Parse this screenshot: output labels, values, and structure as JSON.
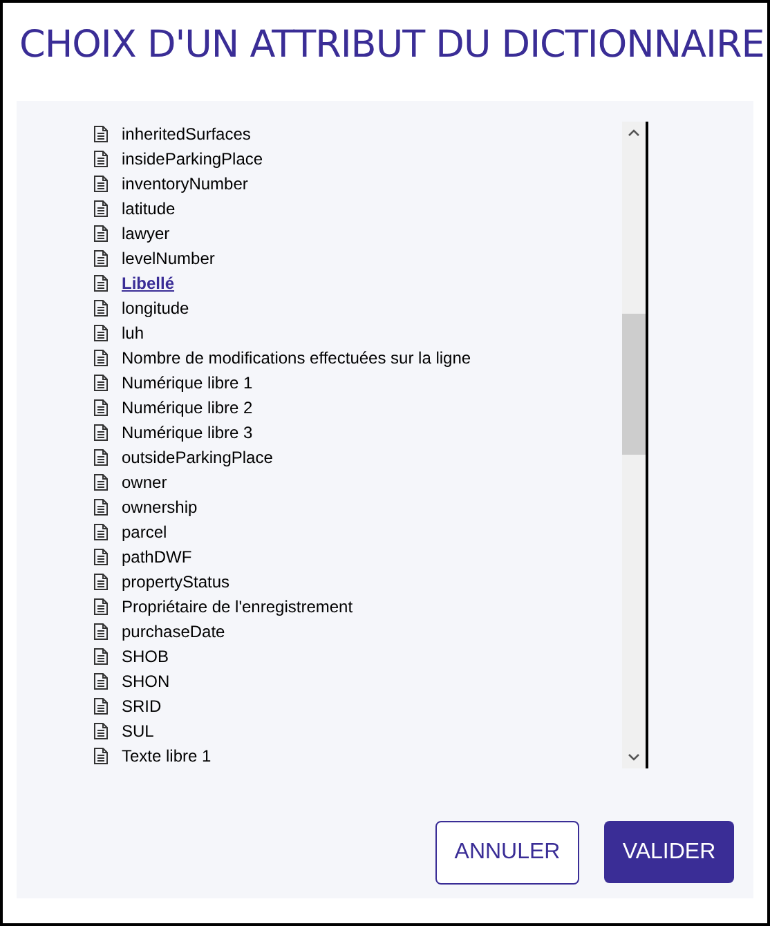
{
  "dialog": {
    "title": "CHOIX D'UN ATTRIBUT DU DICTIONNAIRE"
  },
  "attributes": [
    {
      "label": "inheritedSurfaces",
      "selected": false
    },
    {
      "label": "insideParkingPlace",
      "selected": false
    },
    {
      "label": "inventoryNumber",
      "selected": false
    },
    {
      "label": "latitude",
      "selected": false
    },
    {
      "label": "lawyer",
      "selected": false
    },
    {
      "label": "levelNumber",
      "selected": false
    },
    {
      "label": "Libellé",
      "selected": true
    },
    {
      "label": "longitude",
      "selected": false
    },
    {
      "label": "luh",
      "selected": false
    },
    {
      "label": "Nombre de modifications effectuées sur la ligne",
      "selected": false
    },
    {
      "label": "Numérique libre 1",
      "selected": false
    },
    {
      "label": "Numérique libre 2",
      "selected": false
    },
    {
      "label": "Numérique libre 3",
      "selected": false
    },
    {
      "label": "outsideParkingPlace",
      "selected": false
    },
    {
      "label": "owner",
      "selected": false
    },
    {
      "label": "ownership",
      "selected": false
    },
    {
      "label": "parcel",
      "selected": false
    },
    {
      "label": "pathDWF",
      "selected": false
    },
    {
      "label": "propertyStatus",
      "selected": false
    },
    {
      "label": "Propriétaire de l'enregistrement",
      "selected": false
    },
    {
      "label": "purchaseDate",
      "selected": false
    },
    {
      "label": "SHOB",
      "selected": false
    },
    {
      "label": "SHON",
      "selected": false
    },
    {
      "label": "SRID",
      "selected": false
    },
    {
      "label": "SUL",
      "selected": false
    },
    {
      "label": "Texte libre 1",
      "selected": false
    }
  ],
  "buttons": [
    {
      "label": "ANNULER",
      "kind": "secondary"
    },
    {
      "label": "VALIDER",
      "kind": "primary"
    }
  ]
}
